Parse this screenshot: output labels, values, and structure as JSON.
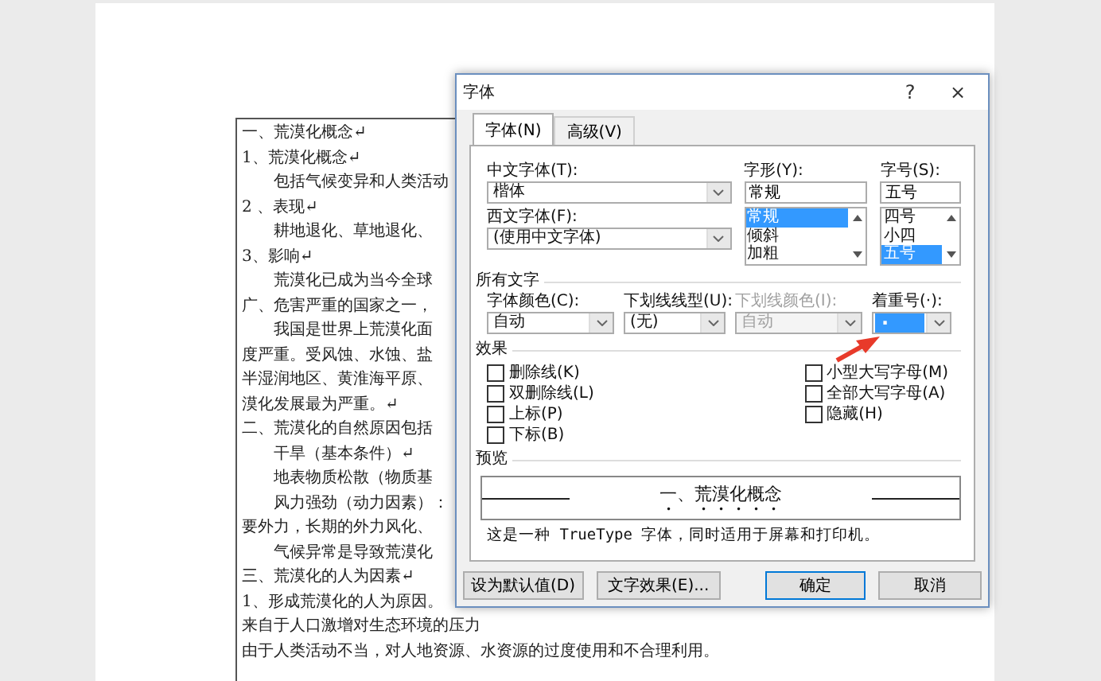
{
  "document": {
    "lines": [
      {
        "text": "一、荒漠化概念↵",
        "indent": false
      },
      {
        "text": "1、荒漠化概念↵",
        "indent": false
      },
      {
        "text": "包括气候变异和人类活动",
        "indent": true
      },
      {
        "text": "2 、表现↵",
        "indent": false
      },
      {
        "text": "耕地退化、草地退化、",
        "indent": true
      },
      {
        "text": "3、影响↵",
        "indent": false
      },
      {
        "text": "荒漠化已成为当今全球",
        "indent": true
      },
      {
        "text": "广、危害严重的国家之一，",
        "indent": false
      },
      {
        "text": "我国是世界上荒漠化面",
        "indent": true
      },
      {
        "text": "度严重。受风蚀、水蚀、盐",
        "indent": false
      },
      {
        "text": "半湿润地区、黄淮海平原、",
        "indent": false
      },
      {
        "text": "漠化发展最为严重。↵",
        "indent": false
      },
      {
        "text": "二、荒漠化的自然原因包括",
        "indent": false
      },
      {
        "text": "干旱（基本条件）↵",
        "indent": true
      },
      {
        "text": "地表物质松散（物质基",
        "indent": true
      },
      {
        "text": "风力强劲（动力因素）：",
        "indent": true
      },
      {
        "text": "要外力，长期的外力风化、",
        "indent": false
      },
      {
        "text": "气候异常是导致荒漠化",
        "indent": true
      },
      {
        "text": "三、荒漠化的人为因素↵",
        "indent": false
      },
      {
        "text": "1、形成荒漠化的人为原因。",
        "indent": false
      },
      {
        "text": "来自于人口激增对生态环境的压力",
        "indent": false
      },
      {
        "text": "由于人类活动不当，对人地资源、水资源的过度使用和不合理利用。",
        "indent": false
      }
    ]
  },
  "dialog": {
    "title": "字体",
    "help_button": "?",
    "close_button": "×",
    "tabs": [
      {
        "label": "字体(N)",
        "selected": true
      },
      {
        "label": "高级(V)",
        "selected": false
      }
    ],
    "chinese_font": {
      "label": "中文字体(T):",
      "value": "楷体"
    },
    "western_font": {
      "label": "西文字体(F):",
      "value": "(使用中文字体)"
    },
    "style": {
      "label": "字形(Y):",
      "value": "常规",
      "options": [
        {
          "text": "常规",
          "selected": true
        },
        {
          "text": "倾斜",
          "selected": false
        },
        {
          "text": "加粗",
          "selected": false
        }
      ]
    },
    "size": {
      "label": "字号(S):",
      "value": "五号",
      "options": [
        {
          "text": "四号",
          "selected": false
        },
        {
          "text": "小四",
          "selected": false
        },
        {
          "text": "五号",
          "selected": true
        }
      ]
    },
    "all_text": {
      "heading": "所有文字",
      "dropdowns": [
        {
          "label": "字体颜色(C):",
          "value": "自动",
          "disabled": false,
          "focused": false
        },
        {
          "label": "下划线线型(U):",
          "value": "(无)",
          "disabled": false,
          "focused": false
        },
        {
          "label": "下划线颜色(I):",
          "value": "自动",
          "disabled": true,
          "focused": false
        },
        {
          "label": "着重号(·):",
          "value": "·",
          "disabled": false,
          "focused": true
        }
      ]
    },
    "effects": {
      "heading": "效果",
      "left": [
        {
          "label": "删除线(K)",
          "checked": false
        },
        {
          "label": "双删除线(L)",
          "checked": false
        },
        {
          "label": "上标(P)",
          "checked": false
        },
        {
          "label": "下标(B)",
          "checked": false
        }
      ],
      "right": [
        {
          "label": "小型大写字母(M)",
          "checked": false
        },
        {
          "label": "全部大写字母(A)",
          "checked": false
        },
        {
          "label": "隐藏(H)",
          "checked": false
        }
      ]
    },
    "preview": {
      "heading": "预览",
      "sample": "一、荒漠化概念",
      "note": "这是一种 TrueType 字体，同时适用于屏幕和打印机。"
    },
    "buttons": [
      {
        "label": "设为默认值(D)",
        "default": false
      },
      {
        "label": "文字效果(E)...",
        "default": false
      },
      {
        "label": "确定",
        "default": true
      },
      {
        "label": "取消",
        "default": false
      }
    ]
  }
}
